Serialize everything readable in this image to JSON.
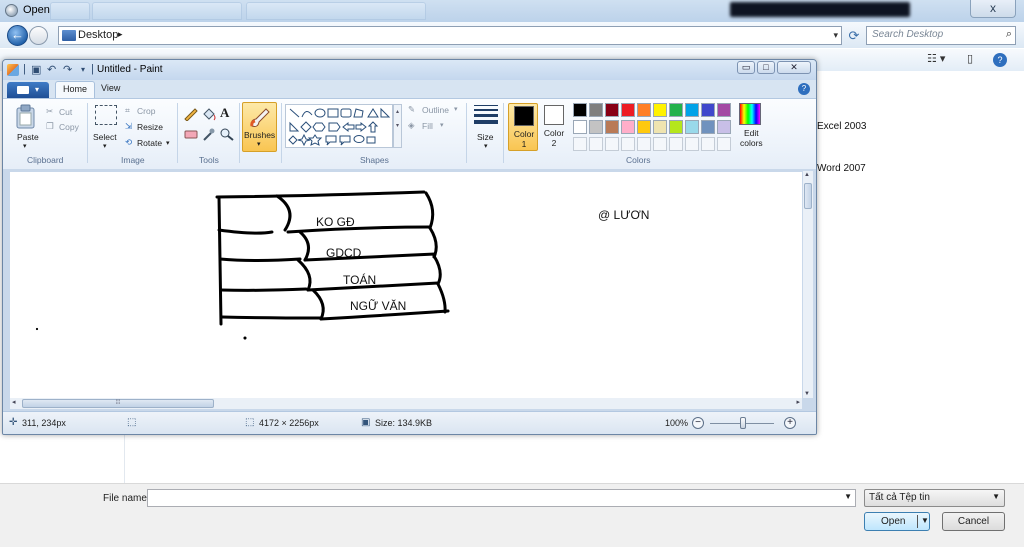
{
  "open_dialog": {
    "title": "Open",
    "close_glyph": "x",
    "address": {
      "location": "Desktop",
      "crumb_arrow": "▸",
      "dropdown": "▾"
    },
    "refresh_icon": "refresh-icon",
    "search": {
      "placeholder": "Search Desktop",
      "icon": "search-icon"
    },
    "files": [
      {
        "label": "Excel 2003"
      },
      {
        "label": "Word 2007"
      }
    ],
    "file_name": {
      "label": "File name:",
      "value": ""
    },
    "file_type": {
      "value": "Tất cả Tệp tin"
    },
    "open_button": "Open",
    "cancel_button": "Cancel"
  },
  "paint": {
    "title": "Untitled - Paint",
    "title_buttons": {
      "minimize": "▭",
      "maximize": "□",
      "close": "✕"
    },
    "tabs": {
      "home": "Home",
      "view": "View"
    },
    "help": "?",
    "ribbon": {
      "clipboard": {
        "paste": "Paste",
        "cut": "Cut",
        "copy": "Copy",
        "group": "Clipboard"
      },
      "image": {
        "select": "Select",
        "crop": "Crop",
        "resize": "Resize",
        "rotate": "Rotate",
        "group": "Image"
      },
      "tools": {
        "group": "Tools"
      },
      "brushes": "Brushes",
      "shapes": {
        "outline": "Outline",
        "fill": "Fill",
        "group": "Shapes"
      },
      "size": "Size",
      "color1": {
        "label": "Color",
        "index": "1",
        "color": "#000000"
      },
      "color2": {
        "label": "Color",
        "index": "2",
        "color": "#ffffff"
      },
      "palette_row1": [
        "#000000",
        "#7f7f7f",
        "#880015",
        "#ed1c24",
        "#ff7f27",
        "#fff200",
        "#22b14c",
        "#00a2e8",
        "#3f48cc",
        "#a349a4"
      ],
      "palette_row2": [
        "#ffffff",
        "#c3c3c3",
        "#b97a57",
        "#ffaec9",
        "#ffc90e",
        "#efe4b0",
        "#b5e61d",
        "#99d9ea",
        "#7092be",
        "#c8bfe7"
      ],
      "edit_colors": [
        "Edit",
        "colors"
      ],
      "colors_group": "Colors"
    },
    "canvas": {
      "labels": {
        "l1": "KO GĐ",
        "l2": "GDCD",
        "l3": "TOÁN",
        "l4": "NGỮ VĂN",
        "sig": "@ LƯƠN"
      }
    },
    "status": {
      "position": "311, 234px",
      "dimensions": "4172 × 2256px",
      "size": "Size: 134.9KB",
      "zoom": "100%",
      "zoom_level_percent": 100
    }
  }
}
